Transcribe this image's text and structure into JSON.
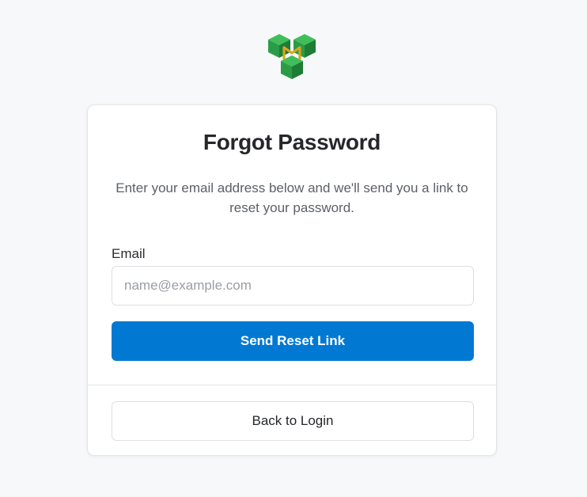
{
  "logo": {
    "icon": "cube-stack-logo-icon",
    "letter": "M",
    "colors": {
      "green_top": "#3fbf5a",
      "green_left": "#2a9c45",
      "green_right": "#1e7d35",
      "letter": "#d9a520"
    }
  },
  "card": {
    "title": "Forgot Password",
    "subtitle": "Enter your email address below and we'll send you a link to reset your password.",
    "email": {
      "label": "Email",
      "placeholder": "name@example.com",
      "value": ""
    },
    "primary_button": "Send Reset Link",
    "secondary_button": "Back to Login"
  },
  "colors": {
    "background": "#f7f8fa",
    "accent": "#0179d3",
    "text": "#25272a",
    "muted_text": "#5c6066"
  }
}
